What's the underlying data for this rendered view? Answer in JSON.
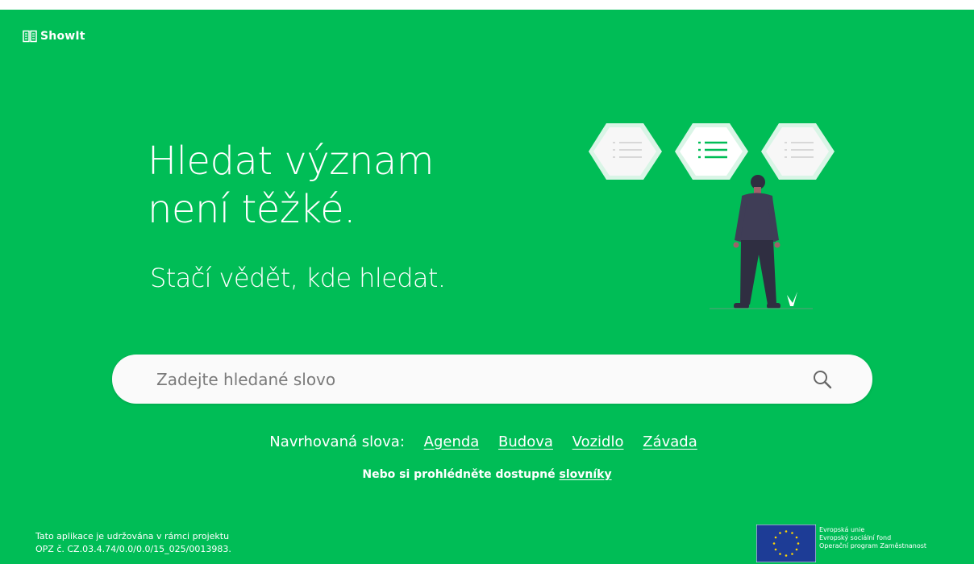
{
  "brand": {
    "name": "ShowIt",
    "logo_icon": "book-icon"
  },
  "hero": {
    "title_line1": "Hledat význam",
    "title_line2": "není těžké.",
    "subtitle": "Stačí vědět, kde hledat."
  },
  "illustration": {
    "icon": "person-with-list-cards-illustration"
  },
  "search": {
    "placeholder": "Zadejte hledané slovo",
    "value": "",
    "icon": "search-icon"
  },
  "suggestions": {
    "label": "Navrhovaná slova:",
    "items": [
      "Agenda",
      "Budova",
      "Vozidlo",
      "Závada"
    ]
  },
  "browse": {
    "prefix": "Nebo si prohlédněte dostupné ",
    "link": "slovníky"
  },
  "footer": {
    "project_line1": "Tato aplikace je udržována v rámci projektu",
    "project_line2": "OPZ č. CZ.03.4.74/0.0/0.0/15_025/0013983.",
    "eu_lines": [
      "Evropská unie",
      "Evropský sociální fond",
      "Operační program Zaměstnanost"
    ],
    "eu_icon": "eu-flag-icon"
  },
  "colors": {
    "background": "#00bd56",
    "search_bg": "#fafafa",
    "text": "#ffffff",
    "eu_blue": "#1d3c96",
    "eu_star": "#ffd600"
  }
}
